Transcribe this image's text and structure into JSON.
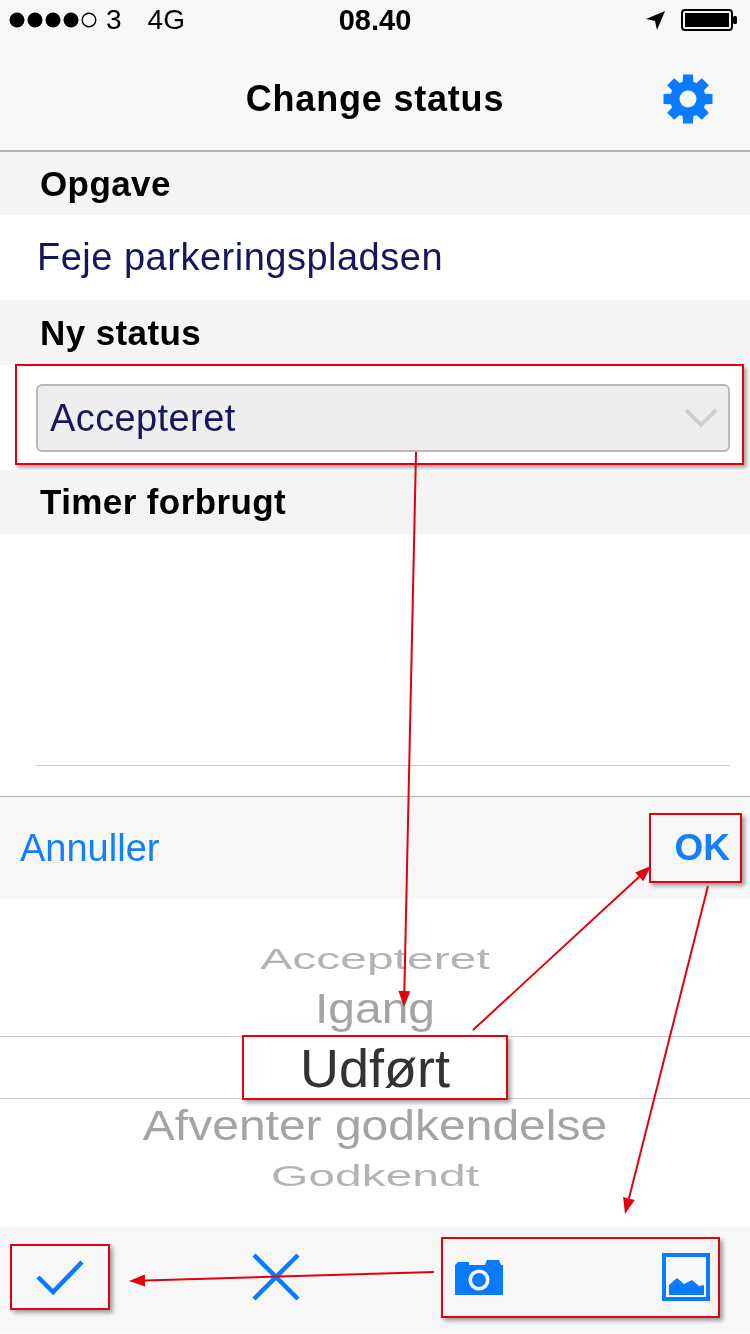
{
  "status_bar": {
    "carrier": "3",
    "network": "4G",
    "time": "08.40"
  },
  "nav_bar": {
    "title": "Change status"
  },
  "sections": [
    {
      "header": "Opgave",
      "kind": "text",
      "value": "Feje parkeringspladsen"
    },
    {
      "header": "Ny status",
      "kind": "select",
      "value": "Accepteret",
      "highlighted": true
    },
    {
      "header": "Timer forbrugt",
      "kind": "timer"
    }
  ],
  "picker": {
    "cancel_label": "Annuller",
    "ok_label": "OK",
    "ok_highlighted": true,
    "options": [
      {
        "label": "Accepteret",
        "selected": false,
        "highlighted": false
      },
      {
        "label": "Igang",
        "selected": false,
        "highlighted": false
      },
      {
        "label": "Udført",
        "selected": true,
        "highlighted": true
      },
      {
        "label": "Afventer godkendelse",
        "selected": false,
        "highlighted": false
      },
      {
        "label": "Godkendt",
        "selected": false,
        "highlighted": false
      }
    ]
  },
  "toolbar": {
    "buttons": [
      {
        "kind": "confirm",
        "highlighted": true
      },
      {
        "kind": "cancel",
        "highlighted": false
      },
      {
        "kind": "camera",
        "highlighted": true
      },
      {
        "kind": "gallery",
        "highlighted": true
      }
    ]
  }
}
